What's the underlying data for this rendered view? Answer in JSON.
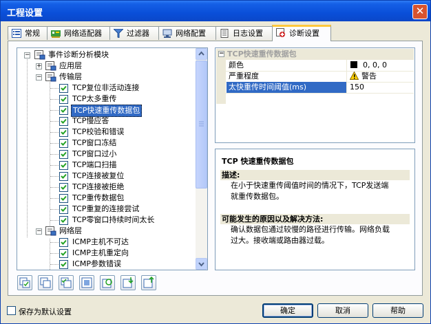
{
  "window": {
    "title": "工程设置",
    "close": "✕"
  },
  "tabs": [
    {
      "label": "常规",
      "active": false
    },
    {
      "label": "网络适配器",
      "active": false
    },
    {
      "label": "过滤器",
      "active": false
    },
    {
      "label": "网络配置",
      "active": false
    },
    {
      "label": "日志设置",
      "active": false
    },
    {
      "label": "诊断设置",
      "active": true
    }
  ],
  "tree": {
    "root": "事件诊断分析模块",
    "app_layer": "应用层",
    "transport_layer": "传输层",
    "transport_items": [
      "TCP复位非活动连接",
      "TCP太多重传",
      "TCP快速重传数据包",
      "TCP慢应答",
      "TCP校验和错误",
      "TCP窗口冻结",
      "TCP窗口过小",
      "TCP端口扫描",
      "TCP连接被复位",
      "TCP连接被拒绝",
      "TCP重传数据包",
      "TCP重复的连接尝试",
      "TCP零窗口持续时间太长"
    ],
    "network_layer": "网络层",
    "network_items": [
      "ICMP主机不可达",
      "ICMP主机重定向",
      "ICMP参数错误"
    ],
    "selected_index": 2
  },
  "props": {
    "header": "TCP快速重传数据包",
    "rows": [
      {
        "name": "颜色",
        "value": "0, 0, 0",
        "swatch": "#000000"
      },
      {
        "name": "严重程度",
        "value": "警告",
        "icon": "warning-icon"
      },
      {
        "name": "太快重传时间阈值(ms)",
        "value": "150",
        "selected": true
      }
    ]
  },
  "desc": {
    "title": "TCP 快速重传数据包",
    "desc_heading": "描述:",
    "desc_line1": "在小于快速重传阈值时间的情况下，TCP发送端",
    "desc_line2": "就重传数据包。",
    "cause_heading": "可能发生的原因以及解决方法:",
    "cause_line1": "确认数据包通过较慢的路径进行传输。网络负载",
    "cause_line2": "过大。接收端或路由器过载。"
  },
  "footer": {
    "save_default": "保存为默认设置",
    "ok": "确定",
    "cancel": "取消",
    "help": "帮助"
  },
  "colors": {
    "title_blue": "#0a4fd9",
    "selection": "#316ac5",
    "check_green": "#21a121",
    "tab_highlight": "#ffc83c"
  }
}
